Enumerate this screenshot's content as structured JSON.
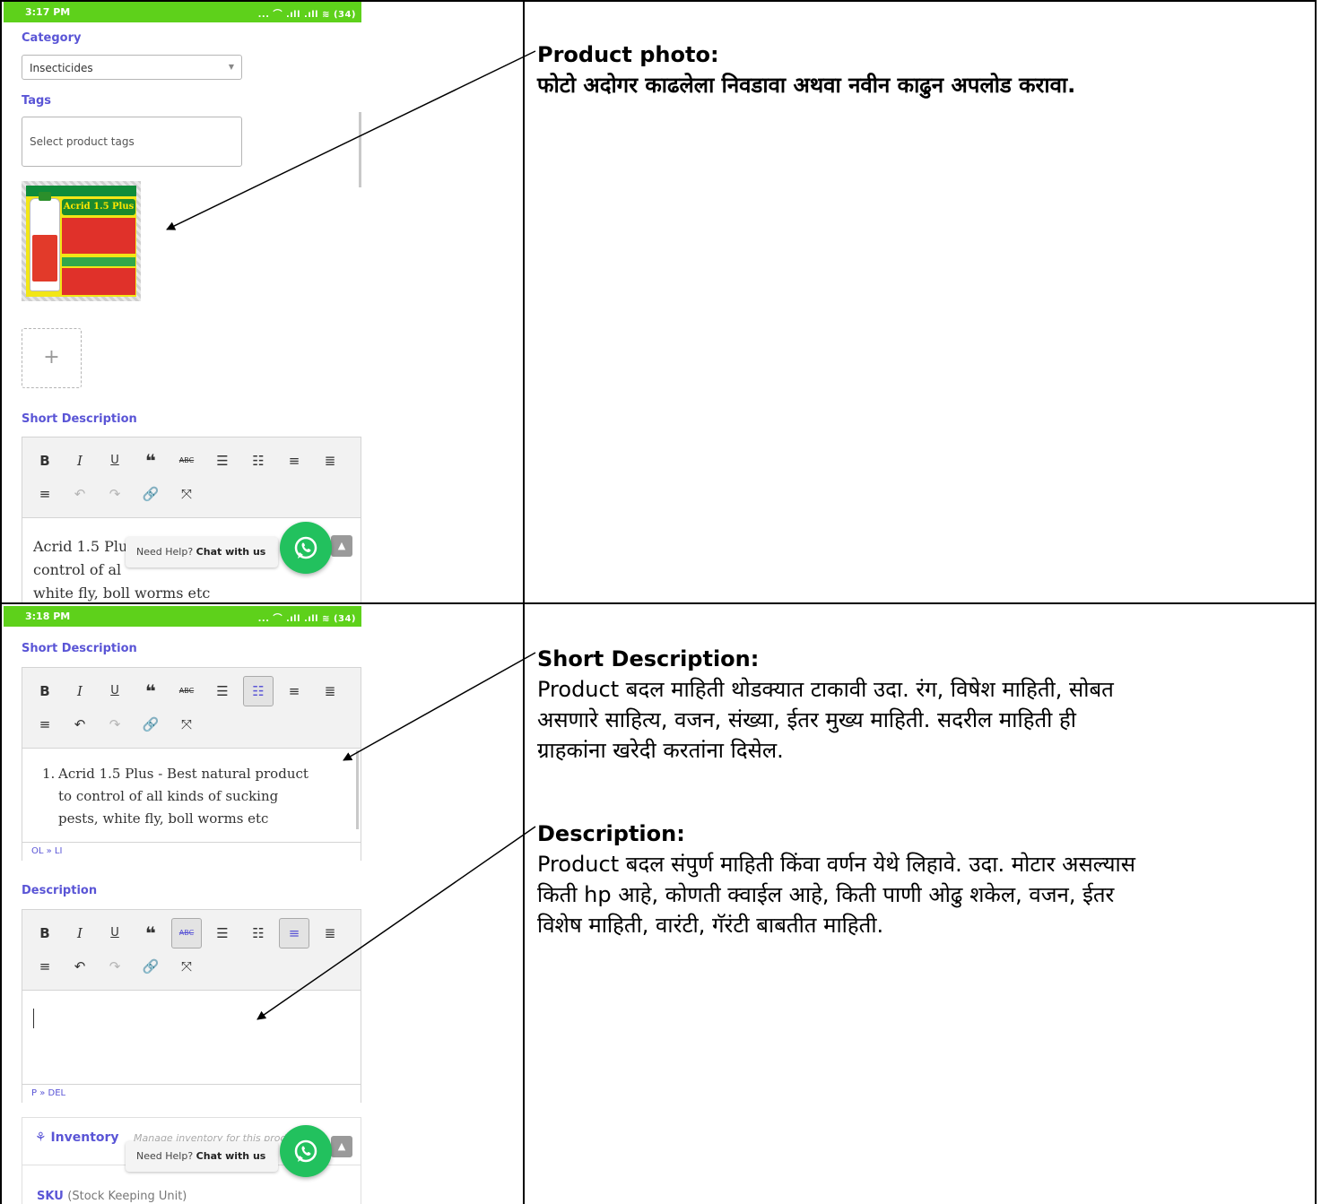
{
  "row1": {
    "status": {
      "time": "3:17 PM",
      "icons": "... ⌒ .ıll .ıll ≋ (34)"
    },
    "category_label": "Category",
    "category_value": "Insecticides",
    "tags_label": "Tags",
    "tags_placeholder": "Select product tags",
    "photo_title": "Acrid 1.5 Plus",
    "add_icon": "+",
    "short_desc_label": "Short Description",
    "editor_text_lines": [
      "Acrid 1.5 Plu",
      "control of al",
      "white fly, boll worms etc"
    ],
    "help_text": "Need Help?",
    "help_link": "Chat with us",
    "heading": "Product photo:",
    "instruction": "फोटो अदोगर काढलेला निवडावा अथवा नवीन काढुन अपलोड करावा."
  },
  "row2": {
    "status": {
      "time": "3:18 PM",
      "icons": "... ⌒ .ıll .ıll ≋ (34)"
    },
    "short_desc_label": "Short Description",
    "short_desc_item_number": "1.",
    "short_desc_lines": [
      "Acrid 1.5 Plus - Best natural product",
      "to control of all kinds of sucking",
      "pests, white fly, boll worms etc"
    ],
    "short_desc_status": "OL » LI",
    "desc_label": "Description",
    "desc_status": "P » DEL",
    "inventory_label": "Inventory",
    "inventory_sub": "Manage inventory for this prod",
    "sku_label": "SKU",
    "sku_hint": "(Stock Keeping Unit)",
    "help_text": "Need Help?",
    "help_link": "Chat with us",
    "short_heading": "Short Description:",
    "short_body": [
      "Product बदल माहिती थोडक्यात टाकावी उदा. रंग, विषेश माहिती, सोबत",
      "असणारे साहित्य, वजन, संख्या, ईतर मुख्य माहिती. सदरील माहिती ही",
      "ग्राहकांना खरेदी करतांना दिसेल."
    ],
    "desc_heading": "Description:",
    "desc_body": [
      "Product बदल संपुर्ण माहिती किंवा वर्णन येथे लिहावे. उदा. मोटार असल्यास",
      "किती hp आहे, कोणती क्वाईल आहे, किती पाणी ओढु शकेल, वजन, ईतर",
      "विशेष माहिती, वारंटी, गॅरंटी बाबतीत माहिती."
    ]
  },
  "toolbar_icons": [
    "bold-icon",
    "italic-icon",
    "underline-icon",
    "blockquote-icon",
    "strikethrough-icon",
    "bullet-list-icon",
    "numbered-list-icon",
    "align-left-icon",
    "align-center-icon",
    "align-right-icon",
    "undo-icon",
    "redo-icon",
    "link-icon",
    "fullscreen-icon"
  ],
  "colors": {
    "status_bar": "#5ed11b",
    "accent": "#5a55d6",
    "whatsapp": "#22c15e"
  }
}
